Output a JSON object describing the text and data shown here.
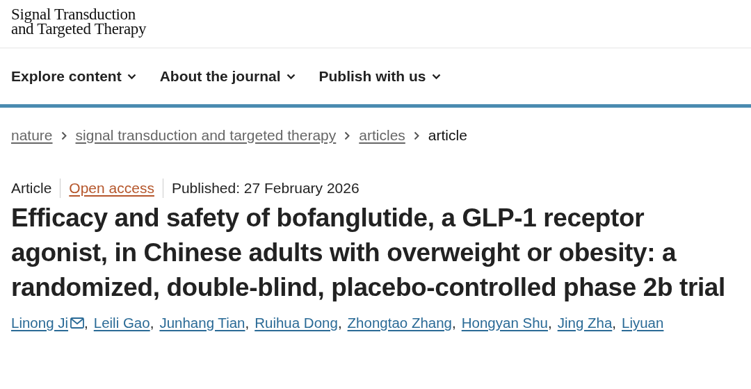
{
  "logo": {
    "lines": [
      "Signal Transduction",
      "and Targeted Therapy"
    ]
  },
  "nav": [
    {
      "label": "Explore content"
    },
    {
      "label": "About the journal"
    },
    {
      "label": "Publish with us"
    }
  ],
  "breadcrumbs": [
    {
      "label": "nature",
      "current": false
    },
    {
      "label": "signal transduction and targeted therapy",
      "current": false
    },
    {
      "label": "articles",
      "current": false
    },
    {
      "label": "article",
      "current": true
    }
  ],
  "meta": {
    "type": "Article",
    "access": "Open access",
    "published": "Published: 27 February 2026"
  },
  "title": "Efficacy and safety of bofanglutide, a GLP-1 receptor agonist, in Chinese adults with overweight or obesity: a randomized, double-blind, placebo-controlled phase 2b trial",
  "authors": [
    {
      "name": "Linong Ji",
      "corresponding": true,
      "separator": ","
    },
    {
      "name": "Leili Gao",
      "corresponding": false,
      "separator": ","
    },
    {
      "name": "Junhang Tian",
      "corresponding": false,
      "separator": ","
    },
    {
      "name": "Ruihua Dong",
      "corresponding": false,
      "separator": ","
    },
    {
      "name": "Zhongtao Zhang",
      "corresponding": false,
      "separator": ","
    },
    {
      "name": "Hongyan Shu",
      "corresponding": false,
      "separator": ","
    },
    {
      "name": "Jing Zha",
      "corresponding": false,
      "separator": ","
    },
    {
      "name": "Liyuan",
      "corresponding": false
    }
  ]
}
